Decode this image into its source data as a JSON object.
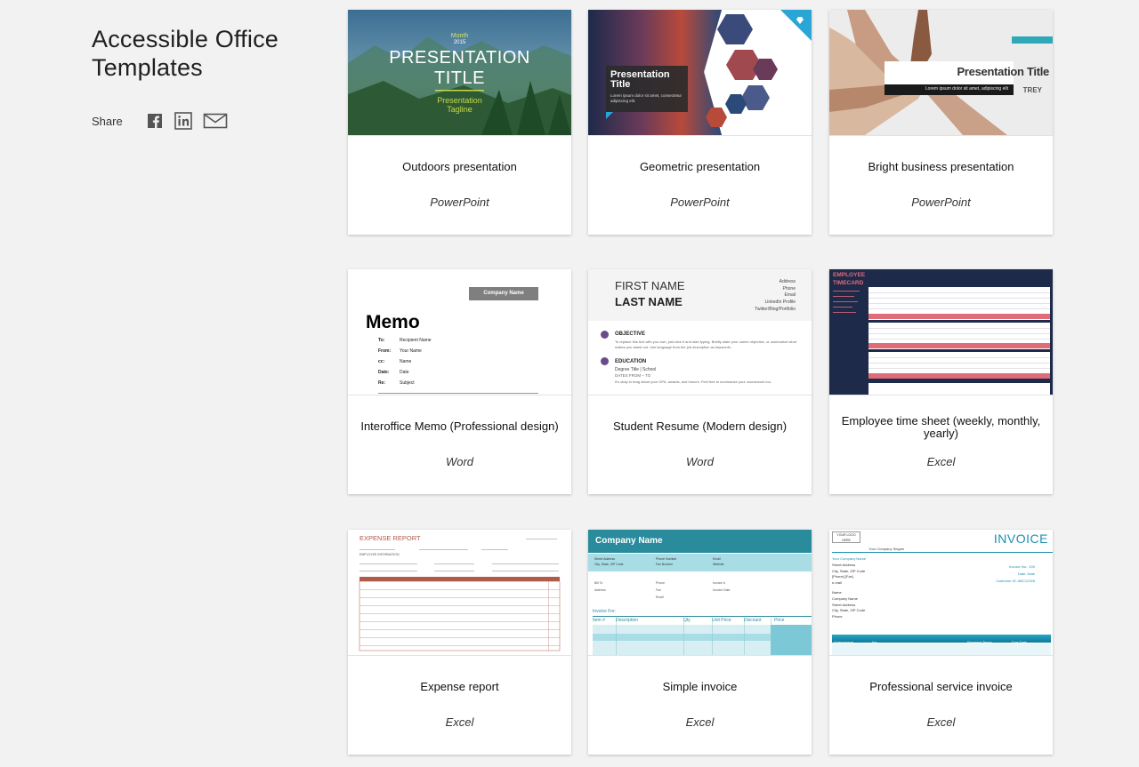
{
  "page": {
    "title_line1": "Accessible Office",
    "title_line2": "Templates",
    "share_label": "Share"
  },
  "cards": [
    {
      "title": "Outdoors presentation",
      "app": "PowerPoint",
      "thumb": {
        "month": "Month",
        "year": "2015",
        "heading1": "PRESENTATION",
        "heading2": "TITLE",
        "tag1": "Presentation",
        "tag2": "Tagline"
      }
    },
    {
      "title": "Geometric presentation",
      "app": "PowerPoint",
      "thumb": {
        "heading1": "Presentation",
        "heading2": "Title",
        "body": "Lorem ipsum dolor sit amet, consectetur adipiscing elit."
      }
    },
    {
      "title": "Bright business presentation",
      "app": "PowerPoint",
      "thumb": {
        "heading": "Presentation Title",
        "body": "Lorem ipsum dolor sit amet, adipiscing elit",
        "brand": "TREY"
      }
    },
    {
      "title": "Interoffice Memo (Professional design)",
      "app": "Word",
      "thumb": {
        "company": "Company Name",
        "heading": "Memo",
        "rows": [
          [
            "To:",
            "Recipient Name"
          ],
          [
            "From:",
            "Your Name"
          ],
          [
            "cc:",
            "Name"
          ],
          [
            "Date:",
            "Date"
          ],
          [
            "Re:",
            "Subject"
          ]
        ]
      }
    },
    {
      "title": "Student Resume (Modern design)",
      "app": "Word",
      "thumb": {
        "first": "FIRST NAME",
        "last": "LAST NAME",
        "contacts": [
          "Address",
          "Phone",
          "Email",
          "LinkedIn Profile",
          "Twitter/Blog/Portfolio"
        ],
        "objective": "OBJECTIVE",
        "objective_text": "To replace this text with you own, just click it and start typing. Briefly state your career objective, or summarize what makes you stand out. Use language from the job description as keywords.",
        "education": "EDUCATION",
        "degree": "Degree Title | School",
        "dates": "DATES FROM – TO",
        "edu_text": "It's okay to brag about your GPA, awards, and honors. Feel free to summarize your coursework too."
      }
    },
    {
      "title": "Employee time sheet (weekly, monthly, yearly)",
      "app": "Excel",
      "thumb": {
        "heading1": "EMPLOYEE",
        "heading2": "TIMECARD"
      }
    },
    {
      "title": "Expense report",
      "app": "Excel",
      "thumb": {
        "heading": "EXPENSE REPORT",
        "sub": "EMPLOYEE INFORMATION"
      }
    },
    {
      "title": "Simple invoice",
      "app": "Excel",
      "thumb": {
        "company": "Company Name",
        "invoice_for": "Invoice For:",
        "cols": [
          "Item #",
          "Description",
          "Qty",
          "Unit Price",
          "Discount",
          "Price"
        ],
        "labels": [
          "Street Address",
          "City, State, ZIP Code",
          "Phone Number",
          "Fax Number",
          "Email",
          "Website",
          "Bill To",
          "Address",
          "Phone",
          "Fax",
          "Email",
          "Invoice #",
          "Invoice Date"
        ]
      }
    },
    {
      "title": "Professional service invoice",
      "app": "Excel",
      "thumb": {
        "logo": "YOUR LOGO HERE",
        "slogan": "Your Company Slogan",
        "heading": "INVOICE",
        "left": [
          "Your Company Name",
          "Street Address",
          "City, State, ZIP Code",
          "[Phone] [Fax]",
          "e-mail",
          "",
          "Name",
          "Company Name",
          "Street Address",
          "City, State, ZIP Code",
          "Phone"
        ],
        "right": [
          "Invoice No.: 100",
          "Date: Date",
          "Customer ID: ABC12345"
        ],
        "bar": [
          "Salesperson",
          "Job",
          "Payment Terms",
          "Due Date"
        ]
      }
    }
  ],
  "colors": {
    "memo_bar": "#7f7f7f",
    "geo_accent": "#2aa6d6",
    "invoice_teal": "#2a8b9c",
    "invoice_light": "#a8dde6",
    "timecard_bg": "#1e2a4a",
    "timecard_pink": "#e06c7a",
    "expense_red": "#b05a4a",
    "pro_invoice_blue": "#1e8fb0"
  }
}
